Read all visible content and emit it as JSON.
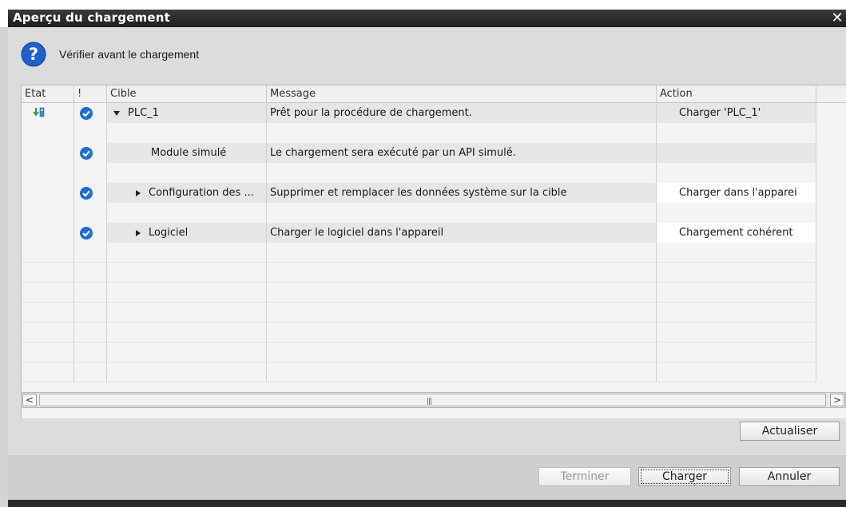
{
  "window": {
    "title": "Aperçu du chargement",
    "close_glyph": "✕"
  },
  "prompt": {
    "icon": "question-icon",
    "text": "Vérifier avant le chargement"
  },
  "table": {
    "headers": {
      "etat": "Etat",
      "warn": "!",
      "cible": "Cible",
      "message": "Message",
      "action": "Action"
    },
    "rows": [
      {
        "cible": "PLC_1",
        "message": "Prêt pour la procédure de chargement.",
        "action": "Charger 'PLC_1'"
      },
      {
        "cible": "Module simulé",
        "message": "Le chargement sera exécuté par un API simulé.",
        "action": ""
      },
      {
        "cible": "Configuration des ...",
        "message": "Supprimer et remplacer les données système sur la cible",
        "action": "Charger dans l'apparei"
      },
      {
        "cible": "Logiciel",
        "message": "Charger le logiciel dans l'appareil",
        "action": "Chargement cohérent"
      }
    ]
  },
  "scrollbar": {
    "left_glyph": "<",
    "right_glyph": ">",
    "grip": "|||"
  },
  "buttons": {
    "actualiser": "Actualiser",
    "terminer": "Terminer",
    "charger": "Charger",
    "annuler": "Annuler"
  },
  "colors": {
    "check": "#1a6fd6",
    "status_green": "#2e9e3e",
    "status_blue": "#3a8fd0",
    "title_bar": "#2a2a2a"
  }
}
